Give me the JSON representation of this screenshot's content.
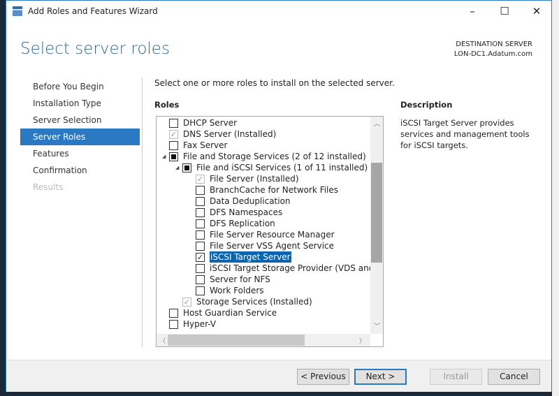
{
  "window": {
    "title": "Add Roles and Features Wizard",
    "minimize": "–",
    "maximize": "☐",
    "close": "✕"
  },
  "page": {
    "title": "Select server roles",
    "dest_label": "DESTINATION SERVER",
    "dest_server": "LON-DC1.Adatum.com"
  },
  "nav": [
    {
      "label": "Before You Begin",
      "state": "normal"
    },
    {
      "label": "Installation Type",
      "state": "normal"
    },
    {
      "label": "Server Selection",
      "state": "normal"
    },
    {
      "label": "Server Roles",
      "state": "active"
    },
    {
      "label": "Features",
      "state": "normal"
    },
    {
      "label": "Confirmation",
      "state": "normal"
    },
    {
      "label": "Results",
      "state": "disabled"
    }
  ],
  "instruction": "Select one or more roles to install on the selected server.",
  "roles_label": "Roles",
  "roles": [
    {
      "label": "DHCP Server",
      "level": 0,
      "check": "none",
      "expander": ""
    },
    {
      "label": "DNS Server (Installed)",
      "level": 0,
      "check": "installed",
      "expander": ""
    },
    {
      "label": "Fax Server",
      "level": 0,
      "check": "none",
      "expander": ""
    },
    {
      "label": "File and Storage Services (2 of 12 installed)",
      "level": 0,
      "check": "partial",
      "expander": "◢"
    },
    {
      "label": "File and iSCSI Services (1 of 11 installed)",
      "level": 1,
      "check": "partial",
      "expander": "◢"
    },
    {
      "label": "File Server (Installed)",
      "level": 2,
      "check": "installed",
      "expander": ""
    },
    {
      "label": "BranchCache for Network Files",
      "level": 2,
      "check": "none",
      "expander": ""
    },
    {
      "label": "Data Deduplication",
      "level": 2,
      "check": "none",
      "expander": ""
    },
    {
      "label": "DFS Namespaces",
      "level": 2,
      "check": "none",
      "expander": ""
    },
    {
      "label": "DFS Replication",
      "level": 2,
      "check": "none",
      "expander": ""
    },
    {
      "label": "File Server Resource Manager",
      "level": 2,
      "check": "none",
      "expander": ""
    },
    {
      "label": "File Server VSS Agent Service",
      "level": 2,
      "check": "none",
      "expander": ""
    },
    {
      "label": "iSCSI Target Server",
      "level": 2,
      "check": "checked",
      "expander": "",
      "selected": true
    },
    {
      "label": "iSCSI Target Storage Provider (VDS and VSS hardware providers)",
      "level": 2,
      "check": "none",
      "expander": ""
    },
    {
      "label": "Server for NFS",
      "level": 2,
      "check": "none",
      "expander": ""
    },
    {
      "label": "Work Folders",
      "level": 2,
      "check": "none",
      "expander": ""
    },
    {
      "label": "Storage Services (Installed)",
      "level": 1,
      "check": "installed",
      "expander": ""
    },
    {
      "label": "Host Guardian Service",
      "level": 0,
      "check": "none",
      "expander": ""
    },
    {
      "label": "Hyper-V",
      "level": 0,
      "check": "none",
      "expander": ""
    }
  ],
  "description_label": "Description",
  "description": "iSCSI Target Server provides services and management tools for iSCSI targets.",
  "buttons": {
    "previous": "< Previous",
    "next": "Next >",
    "install": "Install",
    "cancel": "Cancel"
  },
  "colors": {
    "accent": "#2b79c2",
    "selection": "#0a64b0",
    "heading": "#2e6a8a"
  }
}
